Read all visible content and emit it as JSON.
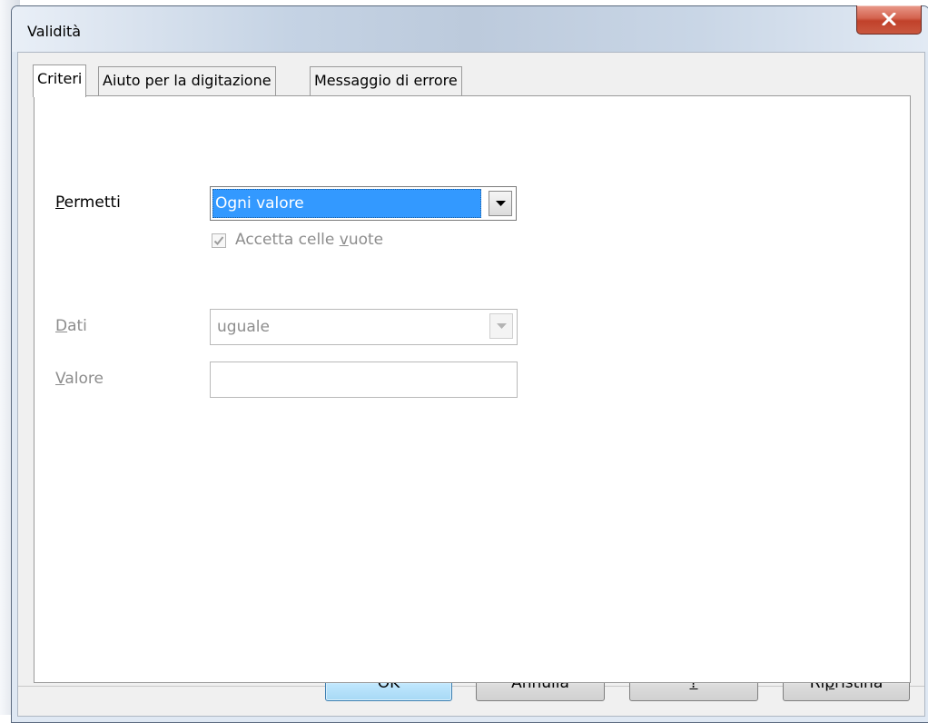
{
  "window": {
    "title": "Validità"
  },
  "tabs": [
    {
      "label": "Criteri",
      "active": true
    },
    {
      "label": "Aiuto per la digitazione",
      "active": false
    },
    {
      "label": "Messaggio di errore",
      "active": false
    }
  ],
  "criteria": {
    "allow": {
      "label_mnemonic": "P",
      "label_rest": "ermetti",
      "selected": "Ogni valore"
    },
    "allow_blank": {
      "label_pre": "Accetta celle ",
      "label_mnemonic": "v",
      "label_post": "uote",
      "checked": true,
      "disabled": true
    },
    "data": {
      "label_mnemonic": "D",
      "label_rest": "ati",
      "selected": "uguale",
      "disabled": true
    },
    "value": {
      "label_mnemonic": "V",
      "label_rest": "alore",
      "value": "",
      "disabled": true
    }
  },
  "buttons": {
    "ok": "OK",
    "cancel": "Annulla",
    "help": "?",
    "reset_pre": "Ri",
    "reset_mnemonic": "p",
    "reset_post": "ristina"
  },
  "colors": {
    "selection": "#3399ff",
    "close_button": "#c1412a",
    "default_button_border": "#3c7fb1",
    "disabled_text": "#8d8d8d"
  }
}
